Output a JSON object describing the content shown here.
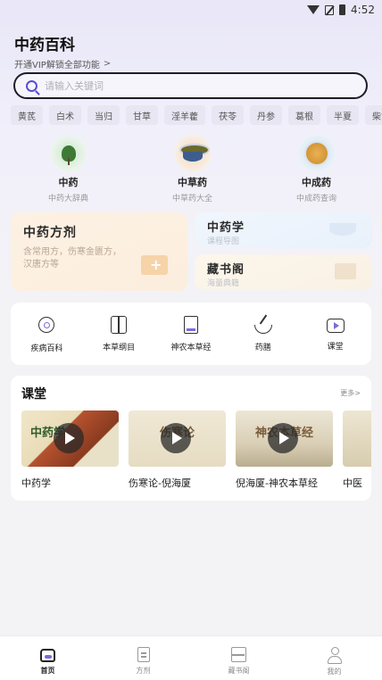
{
  "status_bar": {
    "time": "4:52"
  },
  "header": {
    "title": "中药百科",
    "vip_text": "开通VIP解锁全部功能",
    "vip_chevron": ">"
  },
  "search": {
    "placeholder": "请输入关键词"
  },
  "tags": [
    "黄芪",
    "白术",
    "当归",
    "甘草",
    "淫羊藿",
    "茯苓",
    "丹参",
    "葛根",
    "半夏",
    "柴胡"
  ],
  "categories": [
    {
      "title": "中药",
      "subtitle": "中药大辞典"
    },
    {
      "title": "中草药",
      "subtitle": "中草药大全"
    },
    {
      "title": "中成药",
      "subtitle": "中成药查询"
    }
  ],
  "feature_cards": {
    "big": {
      "title": "中药方剂",
      "desc": "含常用方，伤寒金匮方，汉唐方等"
    },
    "small1": {
      "title": "中药学",
      "desc": "课程导图"
    },
    "small2": {
      "title": "藏书阁",
      "desc": "海量典籍"
    }
  },
  "shortcuts": [
    {
      "label": "疾病百科",
      "icon": "virus-icon"
    },
    {
      "label": "本草纲目",
      "icon": "book-icon"
    },
    {
      "label": "神农本草经",
      "icon": "classic-book-icon"
    },
    {
      "label": "药膳",
      "icon": "mortar-icon"
    },
    {
      "label": "课堂",
      "icon": "video-play-icon"
    }
  ],
  "course": {
    "title": "课堂",
    "more": "更多>",
    "items": [
      {
        "name": "中药学",
        "caption": "中药学"
      },
      {
        "name": "伤寒论-倪海厦",
        "caption": "伤寒论"
      },
      {
        "name": "倪海厦-神农本草经",
        "caption": "神农本草经"
      },
      {
        "name": "中医",
        "caption": ""
      }
    ]
  },
  "tabbar": {
    "items": [
      {
        "label": "首页",
        "active": true
      },
      {
        "label": "方剂",
        "active": false
      },
      {
        "label": "藏书阁",
        "active": false
      },
      {
        "label": "我的",
        "active": false
      }
    ]
  },
  "colors": {
    "accent": "#5a4fd1",
    "tab_active": "#222222",
    "tab_inactive": "#888888"
  }
}
